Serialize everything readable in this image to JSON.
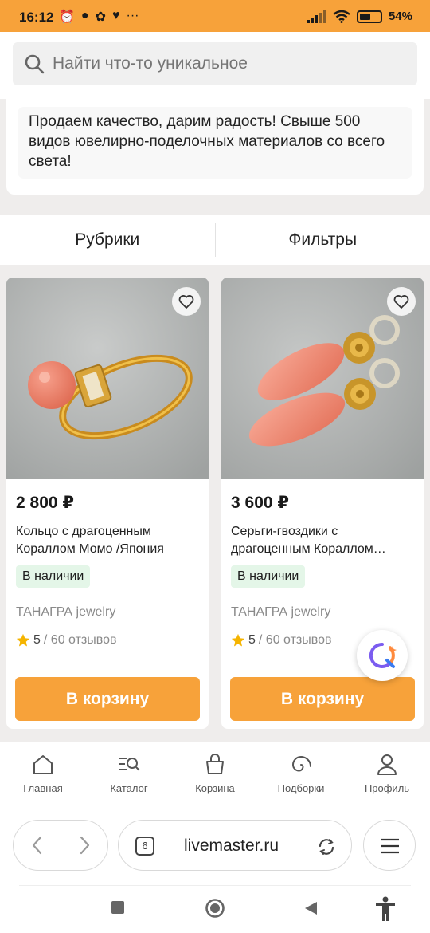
{
  "status_bar": {
    "time": "16:12",
    "battery_percent": "54%",
    "battery_level": 0.54
  },
  "search": {
    "placeholder": "Найти что-то уникальное"
  },
  "intro": {
    "text": "Продаем качество, дарим радость! Свыше 500 видов ювелирно-поделочных материалов со всего света!"
  },
  "tabs": [
    {
      "label": "Рубрики"
    },
    {
      "label": "Фильтры"
    }
  ],
  "products": [
    {
      "price": "2 800 ₽",
      "title": "Кольцо с драгоценным\nКораллом Момо /Япония",
      "availability": "В наличии",
      "seller": "ТАНАГРА jewelry",
      "rating": "5",
      "reviews": "/ 60 отзывов",
      "cart_label": "В корзину"
    },
    {
      "price": "3 600 ₽",
      "title": "Серьги-гвоздики с\nдрагоценным Кораллом…",
      "availability": "В наличии",
      "seller": "ТАНАГРА jewelry",
      "rating": "5",
      "reviews": "/ 60 отзывов",
      "cart_label": "В корзину"
    }
  ],
  "bottom_nav": [
    {
      "label": "Главная",
      "icon": "home-icon"
    },
    {
      "label": "Каталог",
      "icon": "catalog-search-icon"
    },
    {
      "label": "Корзина",
      "icon": "basket-icon"
    },
    {
      "label": "Подборки",
      "icon": "spiral-icon"
    },
    {
      "label": "Профиль",
      "icon": "profile-icon"
    }
  ],
  "browser": {
    "tab_count": "6",
    "url": "livemaster.ru"
  },
  "colors": {
    "accent": "#f7a23a",
    "badge_bg": "#e4f6e8",
    "star": "#f5b400"
  }
}
